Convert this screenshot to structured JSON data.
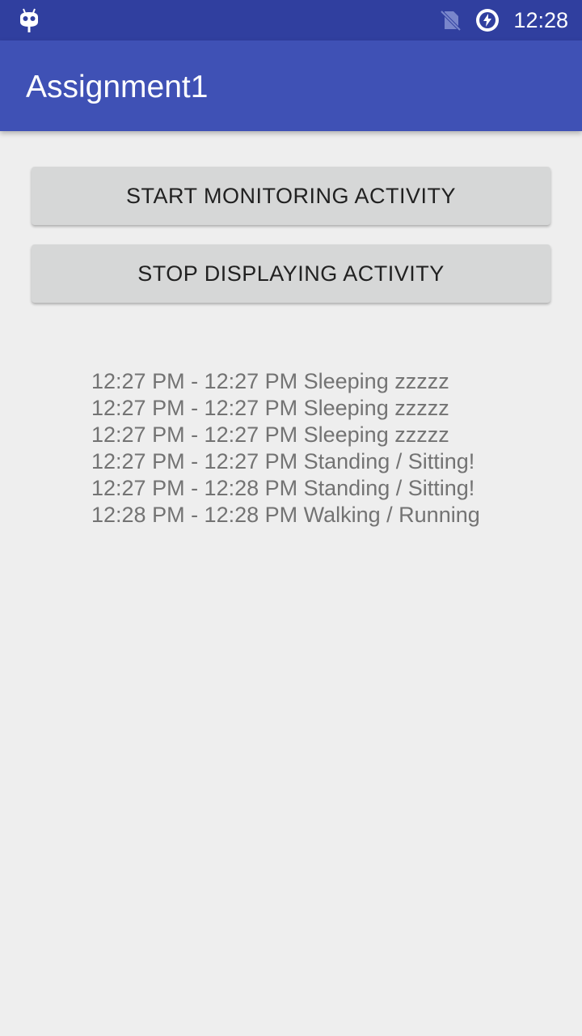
{
  "status_bar": {
    "time": "12:28",
    "icons": [
      "cyanogenmod-icon",
      "no-sim-icon",
      "battery-charging-icon"
    ]
  },
  "app_bar": {
    "title": "Assignment1"
  },
  "buttons": {
    "start_label": "START MONITORING ACTIVITY",
    "stop_label": "STOP DISPLAYING ACTIVITY"
  },
  "activity_log": [
    "12:27 PM - 12:27 PM Sleeping zzzzz",
    "12:27 PM - 12:27 PM Sleeping zzzzz",
    "12:27 PM - 12:27 PM Sleeping zzzzz",
    "12:27 PM - 12:27 PM Standing / Sitting!",
    "12:27 PM - 12:28 PM Standing / Sitting!",
    "12:28 PM - 12:28 PM Walking / Running"
  ],
  "colors": {
    "status_bar": "#303f9f",
    "app_bar": "#3f51b5",
    "background": "#eeeeee",
    "button": "#d6d7d7"
  }
}
